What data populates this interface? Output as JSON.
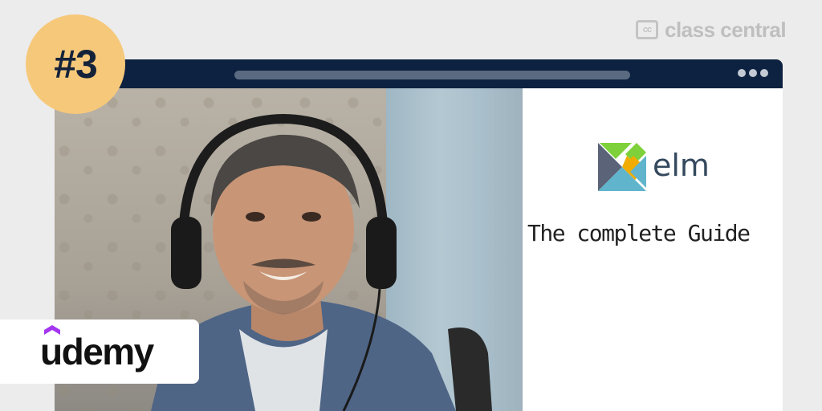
{
  "brand": {
    "icon_text": "cc",
    "name": "class central"
  },
  "badge": {
    "label": "#3"
  },
  "browser": {
    "course": {
      "logo_text": "elm",
      "tagline": "The complete Guide"
    }
  },
  "provider": {
    "name": "udemy"
  },
  "colors": {
    "badge_bg": "#f6c87a",
    "titlebar": "#0d2240",
    "udemy_purple": "#a435f0",
    "elm_green": "#7fd13b",
    "elm_orange": "#f0ad00",
    "elm_blue": "#60b5cc",
    "elm_dark": "#5a6378"
  }
}
